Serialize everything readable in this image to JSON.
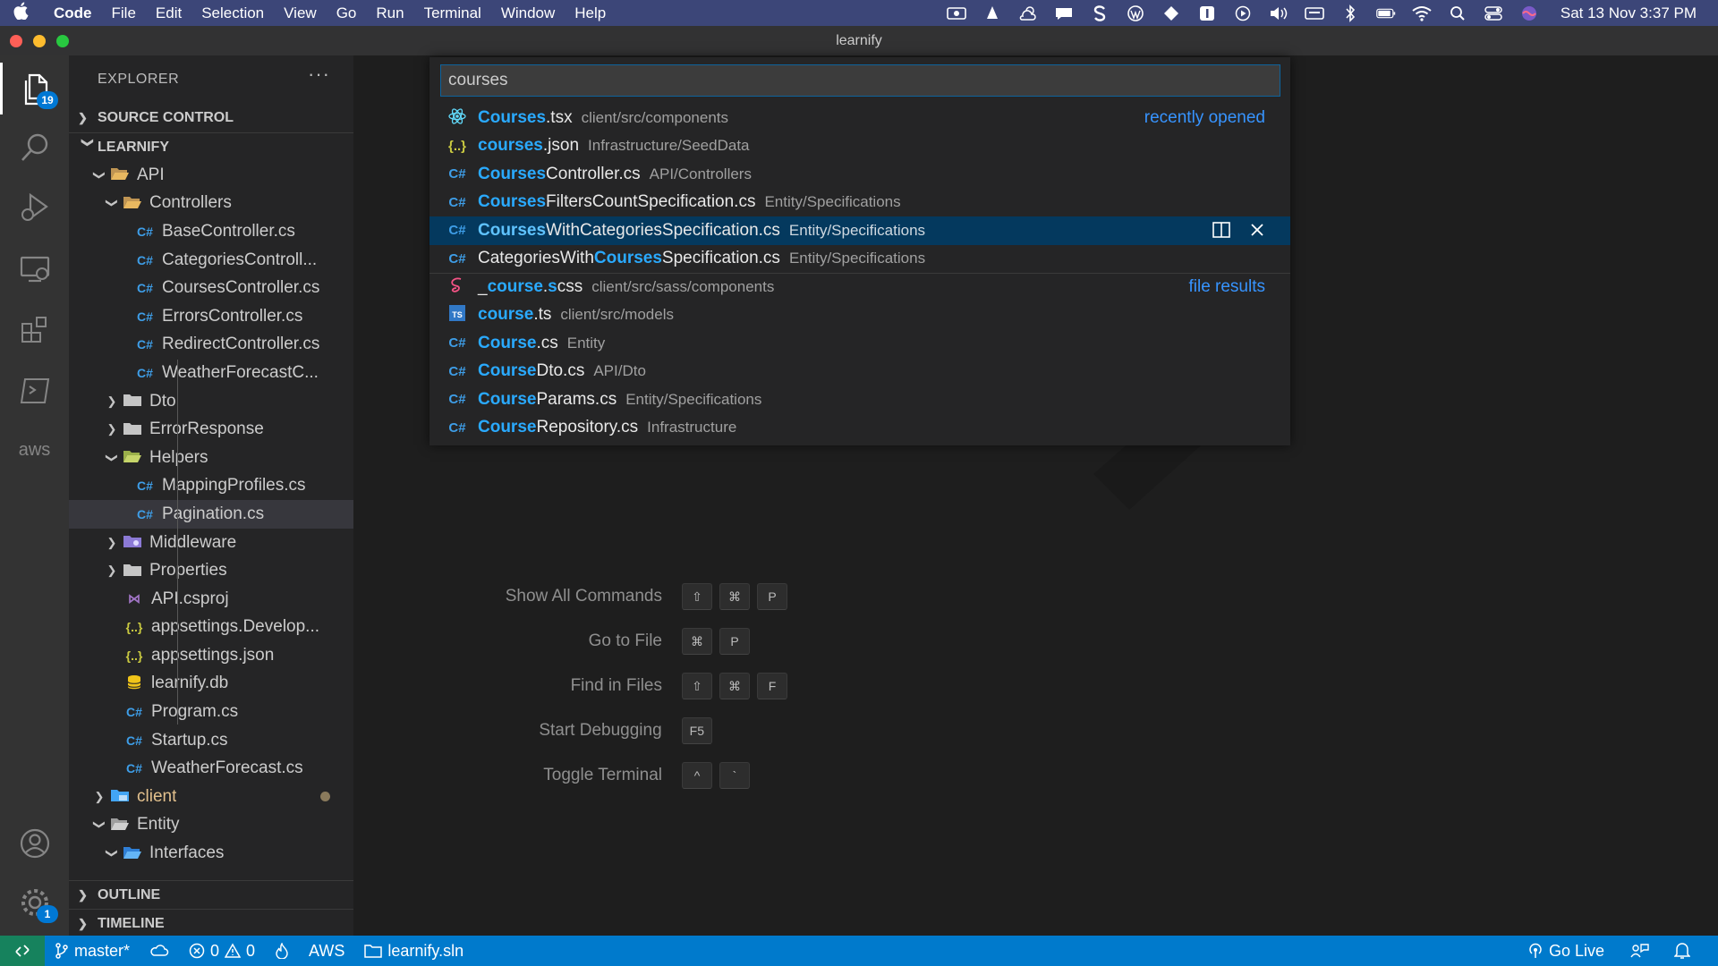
{
  "menubar": {
    "apple": "",
    "app": "Code",
    "items": [
      "File",
      "Edit",
      "Selection",
      "View",
      "Go",
      "Run",
      "Terminal",
      "Window",
      "Help"
    ],
    "clock": "Sat 13 Nov  3:37 PM"
  },
  "titlebar": {
    "title": "learnify"
  },
  "activitybar": {
    "explorer_badge": "19",
    "settings_badge": "1",
    "aws_label": "aws"
  },
  "sidebar": {
    "title": "EXPLORER",
    "more": "···",
    "source_control": "SOURCE CONTROL",
    "workspace": "LEARNIFY",
    "tree": [
      {
        "name": "API"
      },
      {
        "name": "Controllers"
      },
      {
        "name": "BaseController.cs"
      },
      {
        "name": "CategoriesControll..."
      },
      {
        "name": "CoursesController.cs"
      },
      {
        "name": "ErrorsController.cs"
      },
      {
        "name": "RedirectController.cs"
      },
      {
        "name": "WeatherForecastC..."
      },
      {
        "name": "Dto"
      },
      {
        "name": "ErrorResponse"
      },
      {
        "name": "Helpers"
      },
      {
        "name": "MappingProfiles.cs"
      },
      {
        "name": "Pagination.cs"
      },
      {
        "name": "Middleware"
      },
      {
        "name": "Properties"
      },
      {
        "name": "API.csproj"
      },
      {
        "name": "appsettings.Develop..."
      },
      {
        "name": "appsettings.json"
      },
      {
        "name": "learnify.db"
      },
      {
        "name": "Program.cs"
      },
      {
        "name": "Startup.cs"
      },
      {
        "name": "WeatherForecast.cs"
      },
      {
        "name": "client"
      },
      {
        "name": "Entity"
      },
      {
        "name": "Interfaces"
      }
    ],
    "outline": "OUTLINE",
    "timeline": "TIMELINE",
    "icons": {
      "cs": "C#",
      "json": "{..}"
    }
  },
  "quickopen": {
    "query": "courses",
    "results": [
      {
        "match": "Courses",
        "rest": ".tsx",
        "path": "client/src/components",
        "tag": "recently opened"
      },
      {
        "match": "courses",
        "rest": ".json",
        "path": "Infrastructure/SeedData"
      },
      {
        "match": "Courses",
        "rest": "Controller.cs",
        "path": "API/Controllers"
      },
      {
        "match": "Courses",
        "rest": "FiltersCountSpecification.cs",
        "path": "Entity/Specifications"
      },
      {
        "match": "Courses",
        "rest": "WithCategoriesSpecification.cs",
        "path": "Entity/Specifications"
      },
      {
        "pre": "CategoriesWith",
        "match": "Courses",
        "rest": "Specification.cs",
        "path": "Entity/Specifications"
      },
      {
        "pre": "_",
        "match": "course",
        "mid": ".",
        "match2": "s",
        "rest": "css",
        "path": "client/src/sass/components",
        "tag": "file results"
      },
      {
        "match": "course",
        "rest": ".ts",
        "path": "client/src/models"
      },
      {
        "match": "Course",
        "rest": ".cs",
        "path": "Entity"
      },
      {
        "match": "Course",
        "rest": "Dto.cs",
        "path": "API/Dto"
      },
      {
        "match": "Course",
        "rest": "Params.cs",
        "path": "Entity/Specifications"
      },
      {
        "match": "Course",
        "rest": "Repository.cs",
        "path": "Infrastructure"
      }
    ]
  },
  "shortcuts": [
    {
      "label": "Show All Commands",
      "keys": [
        "⇧",
        "⌘",
        "P"
      ]
    },
    {
      "label": "Go to File",
      "keys": [
        "⌘",
        "P"
      ]
    },
    {
      "label": "Find in Files",
      "keys": [
        "⇧",
        "⌘",
        "F"
      ]
    },
    {
      "label": "Start Debugging",
      "keys": [
        "F5"
      ]
    },
    {
      "label": "Toggle Terminal",
      "keys": [
        "^",
        "`"
      ]
    }
  ],
  "statusbar": {
    "branch": "master*",
    "errors": "0",
    "warnings": "0",
    "aws": "AWS",
    "solution": "learnify.sln",
    "golive": "Go Live"
  },
  "colors": {
    "accent": "#007acc",
    "highlight": "#2aaaff",
    "selection": "#04395e"
  }
}
